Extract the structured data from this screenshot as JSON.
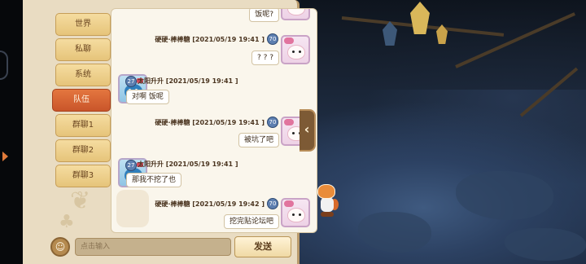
{
  "tabs": [
    {
      "label": "世界",
      "active": false
    },
    {
      "label": "私聊",
      "active": false
    },
    {
      "label": "系统",
      "active": false
    },
    {
      "label": "队伍",
      "active": true
    },
    {
      "label": "群聊1",
      "active": false
    },
    {
      "label": "群聊2",
      "active": false
    },
    {
      "label": "群聊3",
      "active": false
    }
  ],
  "messages": [
    {
      "sender": "",
      "timestamp": "",
      "text": "饭呢?",
      "side": "right",
      "level": ""
    },
    {
      "sender": "硬硬·棒棒糖",
      "timestamp": "[2021/05/19 19:41 ]",
      "text": "? ? ?",
      "side": "right",
      "level": "70"
    },
    {
      "sender": "太阳升升",
      "timestamp": "[2021/05/19 19:41 ]",
      "text": "对啊 饭呢",
      "side": "left",
      "level": "27"
    },
    {
      "sender": "硬硬·棒棒糖",
      "timestamp": "[2021/05/19 19:41 ]",
      "text": "被坑了吧",
      "side": "right",
      "level": "70"
    },
    {
      "sender": "太阳升升",
      "timestamp": "[2021/05/19 19:41 ]",
      "text": "那我不挖了也",
      "side": "left",
      "level": "27"
    },
    {
      "sender": "硬硬·棒棒糖",
      "timestamp": "[2021/05/19 19:42 ]",
      "text": "挖完贴论坛吧",
      "side": "right",
      "level": "70"
    }
  ],
  "input": {
    "placeholder": "点击输入"
  },
  "send_button": {
    "label": "发送"
  },
  "collapse_button": {
    "label": "‹"
  },
  "colors": {
    "active_tab": "#d5612f",
    "tab": "#eed095",
    "panel": "#e9dcc2"
  },
  "icons": {
    "emoji_button": "smiley-icon",
    "collapse": "chevron-left-icon"
  }
}
